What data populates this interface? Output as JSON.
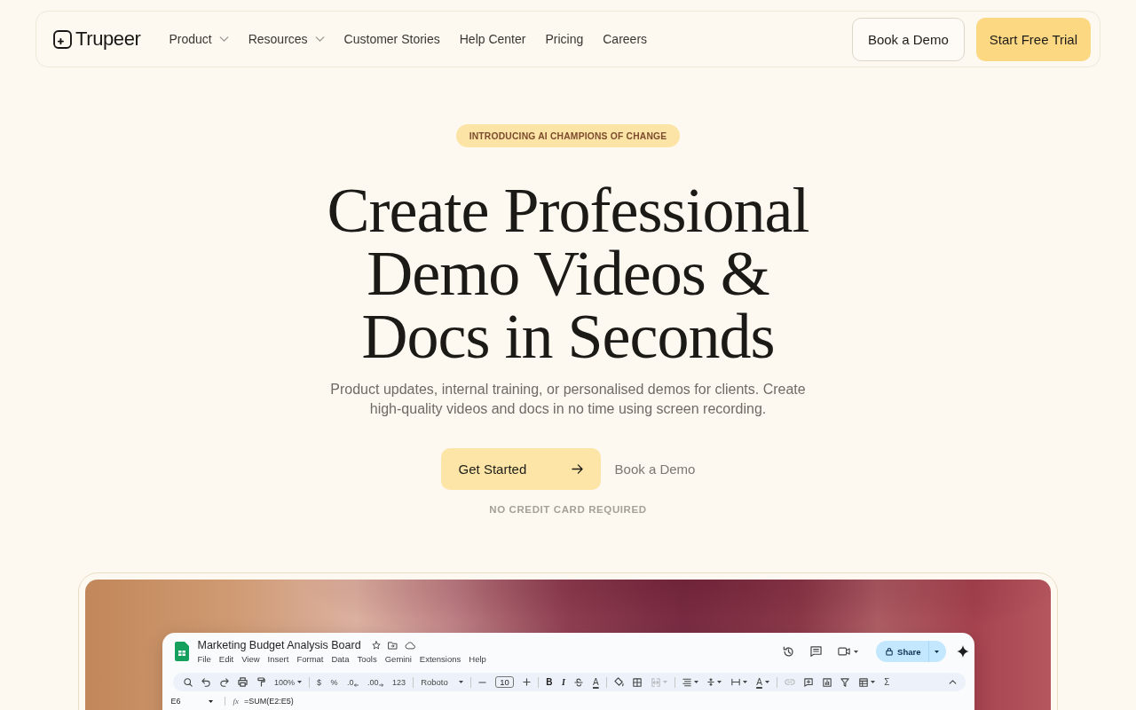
{
  "nav": {
    "logo": "Trupeer",
    "links": [
      {
        "label": "Product",
        "dropdown": true
      },
      {
        "label": "Resources",
        "dropdown": true
      },
      {
        "label": "Customer Stories",
        "dropdown": false
      },
      {
        "label": "Help Center",
        "dropdown": false
      },
      {
        "label": "Pricing",
        "dropdown": false
      },
      {
        "label": "Careers",
        "dropdown": false
      }
    ],
    "buttons": [
      {
        "label": "Book a Demo",
        "kind": "outline"
      },
      {
        "label": "Start Free Trial",
        "kind": "primary"
      }
    ]
  },
  "hero": {
    "badge": "INTRODUCING AI CHAMPIONS OF CHANGE",
    "heading": "Create Professional Demo Videos & Docs in Seconds",
    "subtitle": "Product updates, internal training, or personalised demos for clients. Create high-quality videos and docs in no time using screen recording.",
    "primary_button": "Get Started",
    "secondary_link": "Book a Demo",
    "note": "NO CREDIT CARD REQUIRED"
  },
  "preview": {
    "spreadsheet": {
      "title": "Marketing Budget Analysis Board",
      "menu": [
        "File",
        "Edit",
        "View",
        "Insert",
        "Format",
        "Data",
        "Tools",
        "Gemini",
        "Extensions",
        "Help"
      ],
      "share_button": "Share",
      "toolbar": {
        "groups": [
          [
            {
              "kind": "search",
              "disabled": false
            },
            {
              "kind": "undo",
              "disabled": false
            },
            {
              "kind": "redo",
              "disabled": false
            },
            {
              "kind": "print",
              "disabled": false
            },
            {
              "kind": "paint_format",
              "disabled": false
            },
            {
              "kind": "zoom",
              "text": "100%",
              "disabled": false
            }
          ],
          [
            {
              "kind": "currency",
              "text": "$",
              "disabled": false
            },
            {
              "kind": "percent",
              "text": "%",
              "disabled": false
            },
            {
              "kind": "decimal_decrease",
              "text": ".0",
              "disabled": false
            },
            {
              "kind": "decimal_increase",
              "text": ".00",
              "disabled": false
            },
            {
              "kind": "number_format",
              "text": "123",
              "disabled": false
            }
          ],
          [
            {
              "kind": "font",
              "text": "Roboto",
              "disabled": false
            }
          ],
          [
            {
              "kind": "decrease_size",
              "disabled": false
            },
            {
              "kind": "font_size",
              "text": "10",
              "disabled": false
            },
            {
              "kind": "increase_size",
              "disabled": false
            }
          ],
          [
            {
              "kind": "bold",
              "text": "B",
              "disabled": false
            },
            {
              "kind": "italic",
              "text": "I",
              "disabled": false
            },
            {
              "kind": "strikethrough",
              "disabled": false
            },
            {
              "kind": "text_color",
              "text": "A",
              "disabled": false
            }
          ],
          [
            {
              "kind": "fill_color",
              "disabled": false
            },
            {
              "kind": "borders",
              "disabled": false
            },
            {
              "kind": "merge",
              "disabled": true
            }
          ],
          [
            {
              "kind": "halign",
              "disabled": false
            },
            {
              "kind": "valign",
              "disabled": false
            },
            {
              "kind": "wrap",
              "disabled": false
            },
            {
              "kind": "rotate",
              "text": "A",
              "disabled": false
            }
          ],
          [
            {
              "kind": "link",
              "disabled": true
            },
            {
              "kind": "comment",
              "disabled": false
            },
            {
              "kind": "chart",
              "disabled": false
            },
            {
              "kind": "filter",
              "disabled": false
            },
            {
              "kind": "filter_views",
              "disabled": false
            },
            {
              "kind": "functions",
              "text": "Σ",
              "disabled": false
            }
          ]
        ],
        "end": [
          {
            "kind": "collapse",
            "disabled": false
          }
        ]
      },
      "formula_bar": {
        "cell": "E6",
        "label": "fx",
        "formula": "=SUM(E2:E5)"
      }
    }
  }
}
